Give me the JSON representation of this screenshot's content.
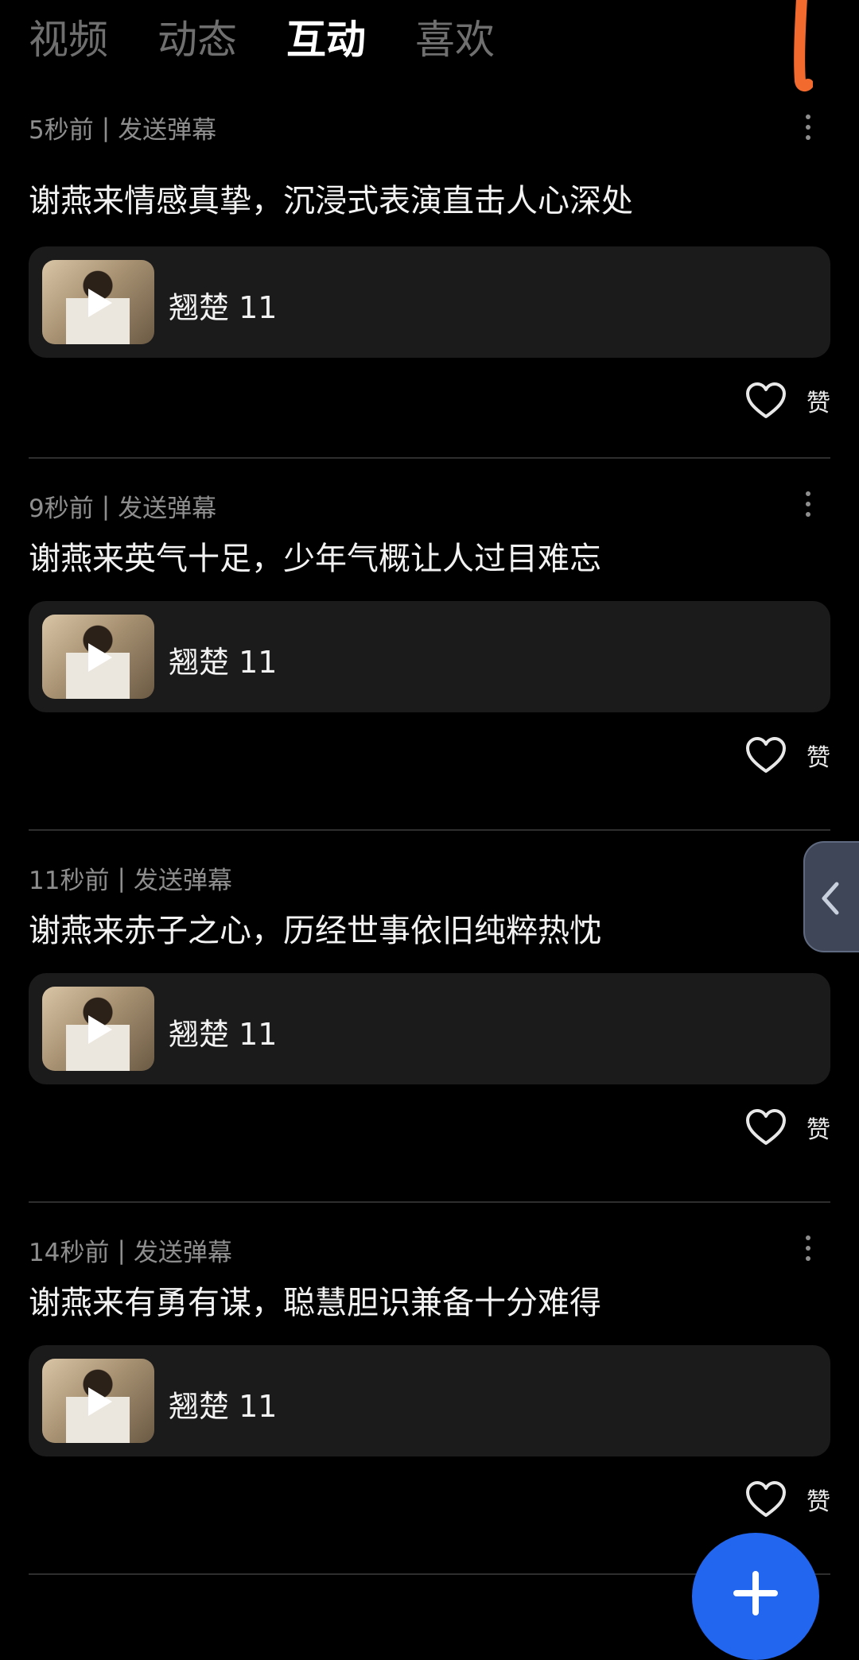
{
  "tabs": [
    {
      "label": "视频",
      "active": false
    },
    {
      "label": "动态",
      "active": false
    },
    {
      "label": "互动",
      "active": true
    },
    {
      "label": "喜欢",
      "active": false
    }
  ],
  "items": [
    {
      "time": "5秒前",
      "separator": "|",
      "action": "发送弹幕",
      "text": "谢燕来情感真挚，沉浸式表演直击人心深处",
      "video_title": "翘楚 11",
      "like_label": "赞"
    },
    {
      "time": "9秒前",
      "separator": "|",
      "action": "发送弹幕",
      "text": "谢燕来英气十足，少年气概让人过目难忘",
      "video_title": "翘楚 11",
      "like_label": "赞"
    },
    {
      "time": "11秒前",
      "separator": "|",
      "action": "发送弹幕",
      "text": "谢燕来赤子之心，历经世事依旧纯粹热忱",
      "video_title": "翘楚 11",
      "like_label": "赞"
    },
    {
      "time": "14秒前",
      "separator": "|",
      "action": "发送弹幕",
      "text": "谢燕来有勇有谋，聪慧胆识兼备十分难得",
      "video_title": "翘楚 11",
      "like_label": "赞"
    }
  ],
  "colors": {
    "background": "#000000",
    "card": "#1b1b1b",
    "fab": "#2266f0",
    "annotation_stroke": "#f26a2e"
  },
  "icons": {
    "more": "more-vertical-icon",
    "play": "play-icon",
    "like": "heart-outline-icon",
    "side": "chevron-left-icon",
    "fab": "plus-icon"
  }
}
